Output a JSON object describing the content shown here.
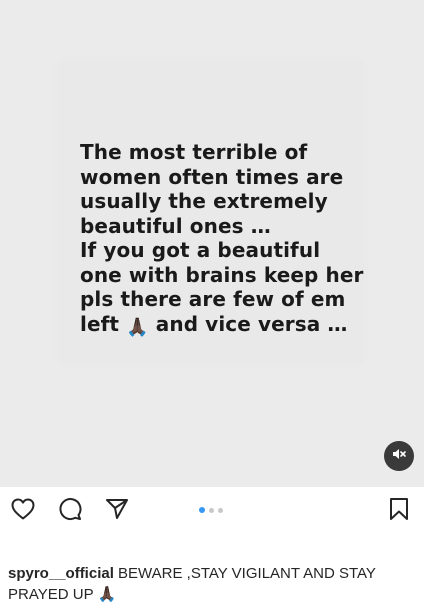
{
  "post": {
    "quote_lines": [
      "The most terrible of",
      "women often times are",
      "usually the extremely",
      "beautiful ones …",
      "If you got a beautiful",
      "one with brains keep her",
      "pls there are few of em",
      "left"
    ],
    "quote_last_line_tail": "and vice versa …",
    "pray_emoji": "🙏🏿"
  },
  "media": {
    "background_color": "#ebebeb",
    "mute_icon": "speaker-muted-icon"
  },
  "actions": {
    "like_icon": "heart-icon",
    "comment_icon": "comment-bubble-icon",
    "share_icon": "paper-plane-icon",
    "save_icon": "bookmark-icon",
    "carousel_count": 3,
    "carousel_active_index": 1,
    "accent_color": "#3897f0"
  },
  "caption": {
    "username": "spyro__official",
    "text": "BEWARE ,STAY VIGILANT AND STAY PRAYED UP",
    "emoji": "🙏🏿"
  }
}
